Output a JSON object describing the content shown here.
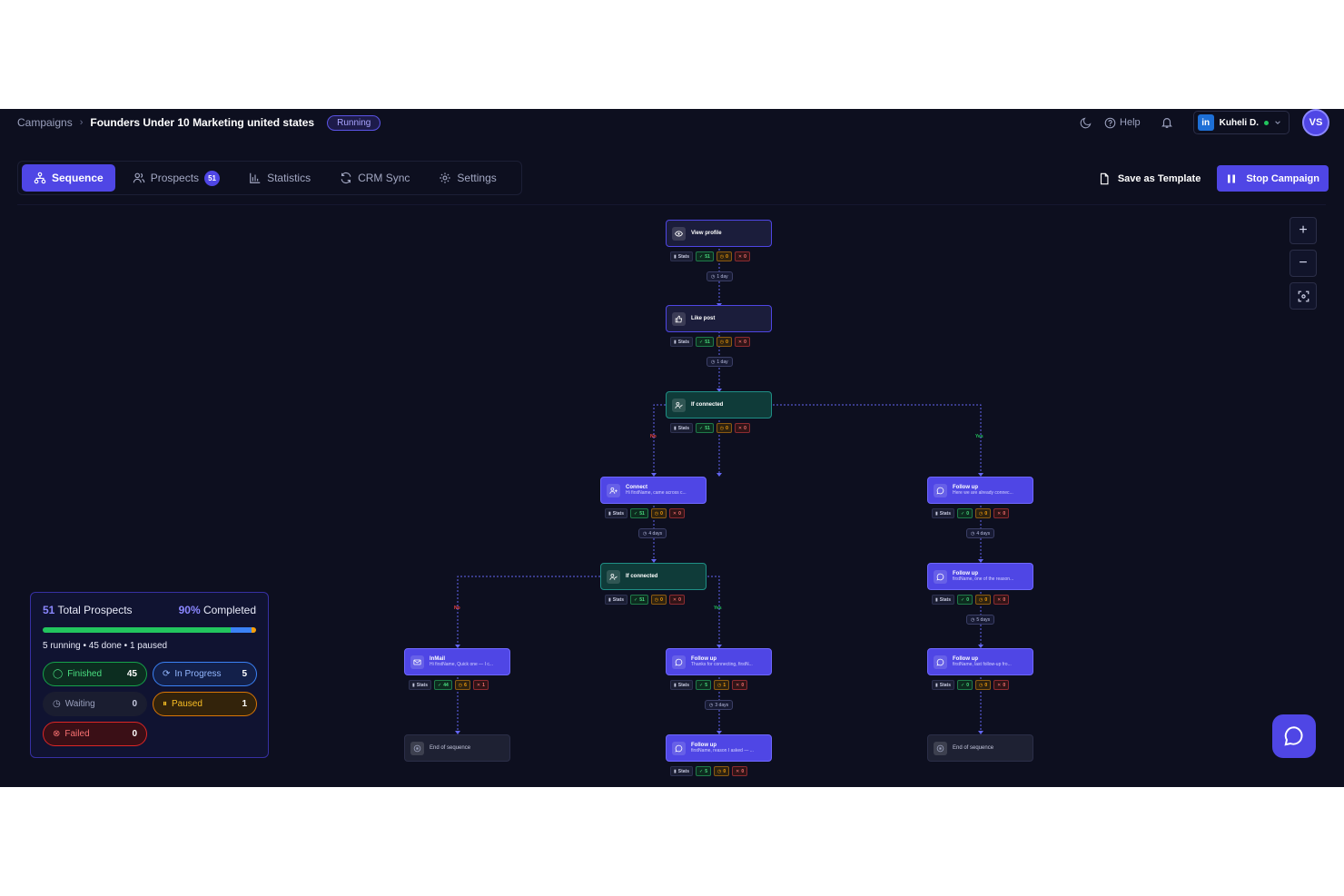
{
  "header": {
    "breadcrumb_root": "Campaigns",
    "campaign_title": "Founders Under 10 Marketing united states",
    "status": "Running",
    "help": "Help",
    "account_name": "Kuheli D.",
    "avatar_initials": "VS"
  },
  "tabs": [
    {
      "label": "Sequence",
      "active": true
    },
    {
      "label": "Prospects",
      "count": "51"
    },
    {
      "label": "Statistics"
    },
    {
      "label": "CRM Sync"
    },
    {
      "label": "Settings"
    }
  ],
  "actions": {
    "save_template": "Save as Template",
    "stop_campaign": "Stop Campaign"
  },
  "colors": {
    "accent": "#4f46e5",
    "canvas_bg": "#0d0f1f",
    "green": "#22c55e",
    "orange": "#f59e0b",
    "red": "#ef4444"
  },
  "flow": {
    "stats_label": "Stats",
    "no_label": "No",
    "yes_label": "Yes",
    "nodes": {
      "view_profile": {
        "title": "View profile",
        "sub": "",
        "g": "51",
        "o": "0",
        "r": "0"
      },
      "like_post": {
        "title": "Like post",
        "sub": "",
        "g": "51",
        "o": "0",
        "r": "0"
      },
      "if_connected_1": {
        "title": "If connected",
        "sub": "",
        "g": "51",
        "o": "0",
        "r": "0"
      },
      "connect": {
        "title": "Connect",
        "sub": "Hi firstName, came across c...",
        "g": "51",
        "o": "0",
        "r": "0"
      },
      "follow_up_r1": {
        "title": "Follow up",
        "sub": "Here we are already connec...",
        "g": "0",
        "o": "0",
        "r": "0"
      },
      "if_connected_2": {
        "title": "If connected",
        "sub": "",
        "g": "51",
        "o": "0",
        "r": "0"
      },
      "follow_up_r2": {
        "title": "Follow up",
        "sub": "firstName, one of the reason...",
        "g": "0",
        "o": "0",
        "r": "0"
      },
      "inmail": {
        "title": "InMail",
        "sub": "Hi firstName, Quick one — I c...",
        "g": "44",
        "o": "6",
        "r": "1"
      },
      "follow_up_m1": {
        "title": "Follow up",
        "sub": "Thanks for connecting, firstN...",
        "g": "5",
        "o": "1",
        "r": "0"
      },
      "follow_up_r3": {
        "title": "Follow up",
        "sub": "firstName, last follow-up fro...",
        "g": "0",
        "o": "0",
        "r": "0"
      },
      "end_left": {
        "title": "End of sequence"
      },
      "follow_up_m2": {
        "title": "Follow up",
        "sub": "firstName, reason I asked — ...",
        "g": "5",
        "o": "0",
        "r": "0"
      },
      "end_right": {
        "title": "End of sequence"
      }
    },
    "delays": {
      "d1": "1 day",
      "d2": "1 day",
      "d3": "4 days",
      "d4": "4 days",
      "d5": "5 days",
      "d6": "3 days"
    }
  },
  "summary": {
    "total": "51",
    "total_label": "Total Prospects",
    "completed": "90%",
    "completed_label": "Completed",
    "progress": {
      "done_pct": 88.2,
      "running_pct": 9.8,
      "paused_pct": 2.0
    },
    "line": "5 running • 45 done • 1 paused",
    "pills": {
      "finished": {
        "label": "Finished",
        "value": "45"
      },
      "in_progress": {
        "label": "In Progress",
        "value": "5"
      },
      "waiting": {
        "label": "Waiting",
        "value": "0"
      },
      "paused": {
        "label": "Paused",
        "value": "1"
      },
      "failed": {
        "label": "Failed",
        "value": "0"
      }
    }
  }
}
